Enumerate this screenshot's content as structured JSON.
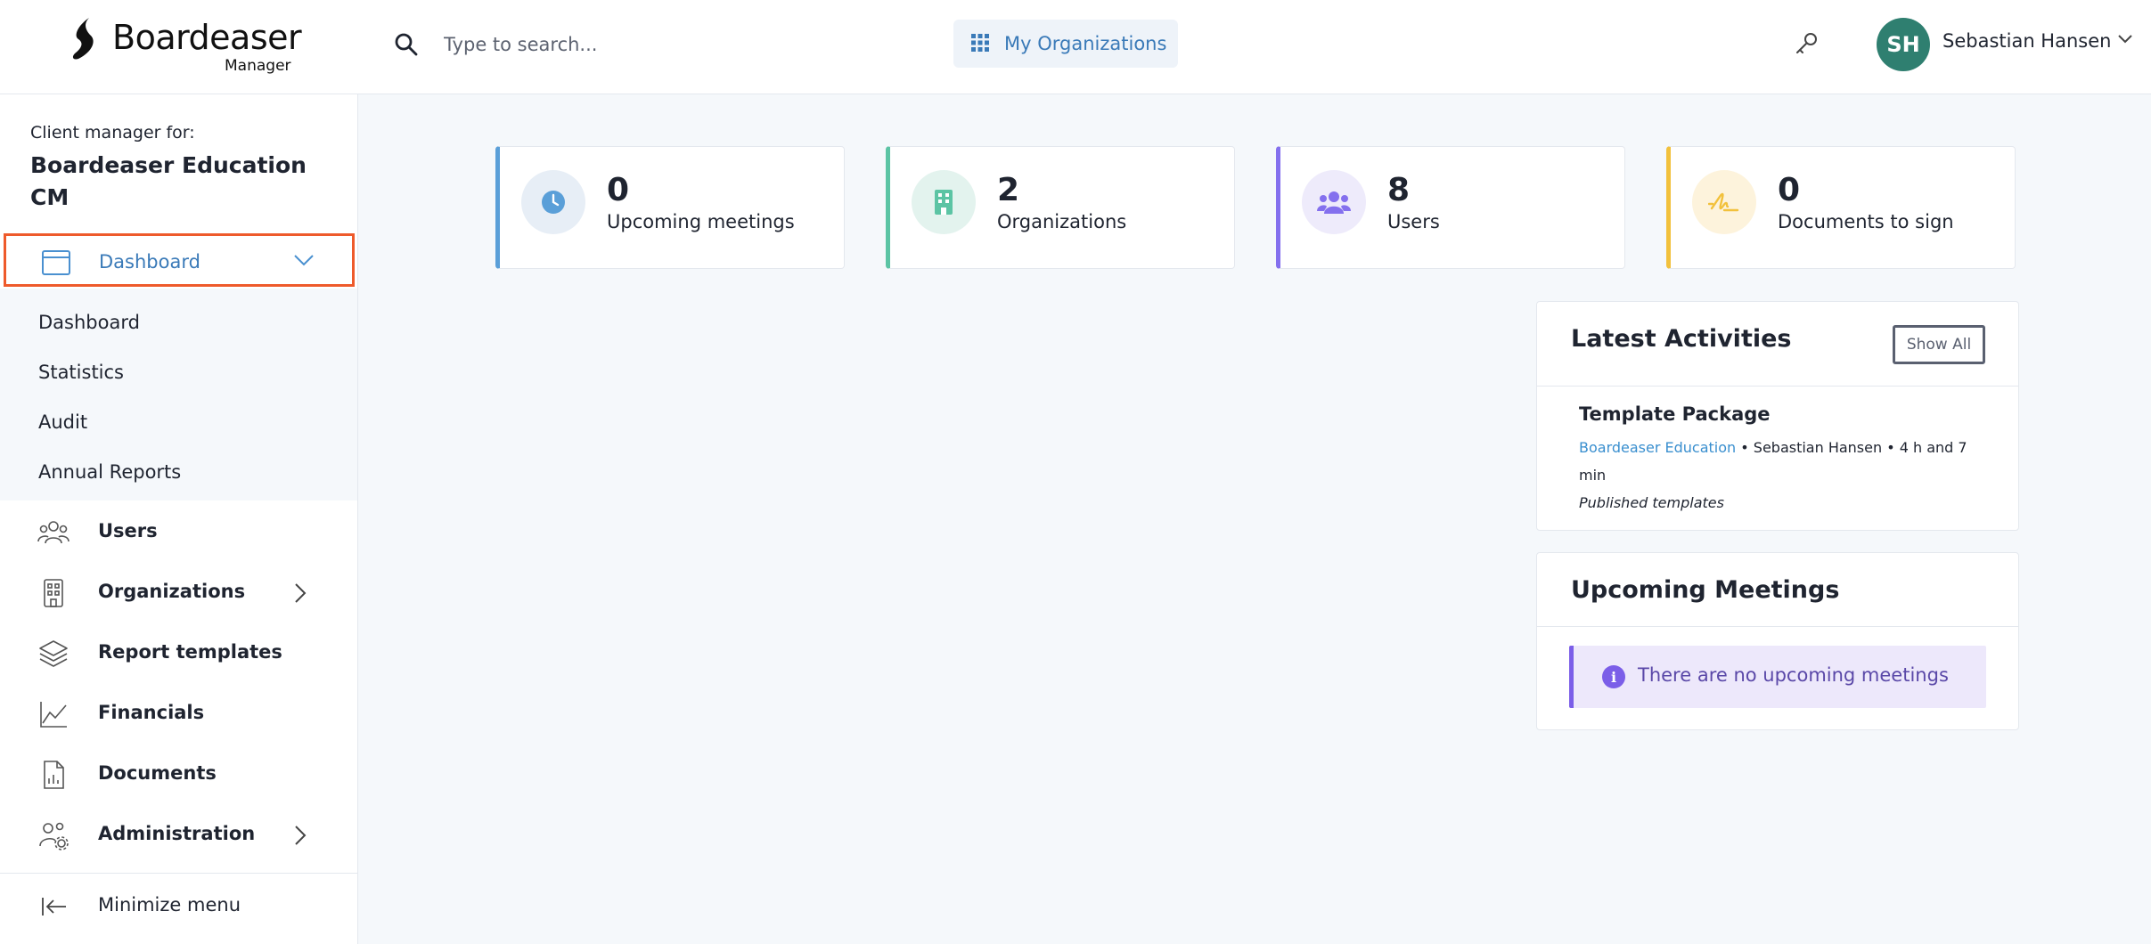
{
  "header": {
    "brand_name": "Boardeaser",
    "brand_sub": "Manager",
    "search_placeholder": "Type to search...",
    "my_orgs_label": "My Organizations",
    "user_initials": "SH",
    "user_name": "Sebastian Hansen"
  },
  "sidebar": {
    "client_label": "Client manager for:",
    "client_name": "Boardeaser Education CM",
    "dashboard_label": "Dashboard",
    "sub_items": [
      "Dashboard",
      "Statistics",
      "Audit",
      "Annual Reports"
    ],
    "nav_items": [
      {
        "label": "Users",
        "icon": "users-icon"
      },
      {
        "label": "Organizations",
        "icon": "building-icon"
      },
      {
        "label": "Report templates",
        "icon": "layers-icon"
      },
      {
        "label": "Financials",
        "icon": "chart-line-icon"
      },
      {
        "label": "Documents",
        "icon": "document-chart-icon"
      },
      {
        "label": "Administration",
        "icon": "admin-users-icon"
      }
    ],
    "minimize_label": "Minimize menu"
  },
  "stats": [
    {
      "value": "0",
      "label": "Upcoming meetings",
      "accent": "#5a9fd8",
      "icon": "clock-icon"
    },
    {
      "value": "2",
      "label": "Organizations",
      "accent": "#5cc4a4",
      "icon": "building-icon"
    },
    {
      "value": "8",
      "label": "Users",
      "accent": "#8470ee",
      "icon": "users-icon"
    },
    {
      "value": "0",
      "label": "Documents to sign",
      "accent": "#f2c13c",
      "icon": "signature-icon"
    }
  ],
  "latest_activities": {
    "title": "Latest Activities",
    "show_all": "Show All",
    "item": {
      "title": "Template Package",
      "org_link": "Boardeaser Education",
      "meta": " • Sebastian Hansen • 4 h and 7 min",
      "note": "Published templates"
    }
  },
  "upcoming_meetings": {
    "title": "Upcoming Meetings",
    "info_text": "There are no upcoming meetings"
  },
  "colors": {
    "link_blue": "#3a7ab8",
    "highlight_orange": "#ee5a2b",
    "avatar_green": "#2f7f70",
    "info_purple": "#7b5ee8"
  }
}
